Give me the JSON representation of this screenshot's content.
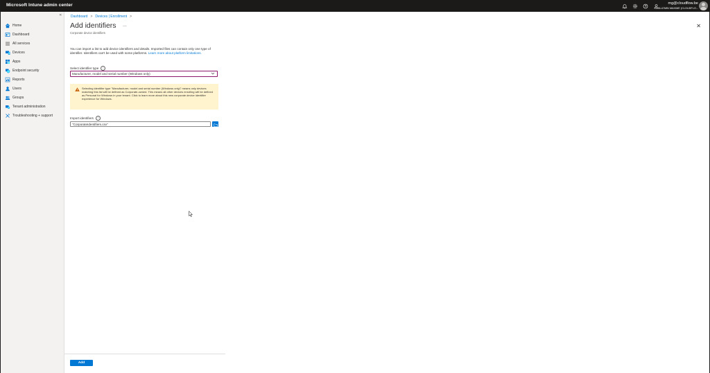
{
  "app": {
    "title": "Microsoft Intune admin center"
  },
  "account": {
    "email": "mg@cloudflow.be",
    "org": "GUILLEMIN MAXIME (CLOUDFLO..."
  },
  "topbar": {
    "icons": [
      "bell-icon",
      "gear-icon",
      "help-icon",
      "feedback-icon"
    ]
  },
  "sidebar": {
    "collapse_glyph": "«",
    "items": [
      {
        "label": "Home",
        "icon": "home-icon"
      },
      {
        "label": "Dashboard",
        "icon": "dashboard-icon"
      },
      {
        "label": "All services",
        "icon": "all-services-icon"
      },
      {
        "label": "Devices",
        "icon": "devices-icon"
      },
      {
        "label": "Apps",
        "icon": "apps-icon"
      },
      {
        "label": "Endpoint security",
        "icon": "endpoint-security-icon"
      },
      {
        "label": "Reports",
        "icon": "reports-icon"
      },
      {
        "label": "Users",
        "icon": "users-icon"
      },
      {
        "label": "Groups",
        "icon": "groups-icon"
      },
      {
        "label": "Tenant administration",
        "icon": "tenant-admin-icon"
      },
      {
        "label": "Troubleshooting + support",
        "icon": "troubleshooting-icon"
      }
    ]
  },
  "breadcrumb": {
    "items": [
      "Dashboard",
      "Devices | Enrollment"
    ],
    "sep": ">"
  },
  "page": {
    "title": "Add identifiers",
    "more": "...",
    "subtitle": "Corporate device identifiers",
    "close": "✕"
  },
  "description": {
    "text": "You can import a list to add device identifiers and details. Imported files can contain only one type of identifier. Identifiers can't be used with some platforms.",
    "link": "Learn more about platform limitations."
  },
  "identifier_type": {
    "label": "Select identifier type",
    "value": "Manufacturer, model and serial number (Windows only)"
  },
  "warning": {
    "text": "Selecting identifier type \"Manufacturer, model and serial number (Windows only)\" means only devices matching this list will be defined as Corporate-owned. This means all other devices enrolling will be defined as Personal for Windows in your tenant. Click to learn more about this new corporate device identifier experience for Windows."
  },
  "import": {
    "label": "Import identifiers",
    "value": "\"CorporateIdentifiers.csv\""
  },
  "footer": {
    "add_label": "Add"
  },
  "colors": {
    "accent": "#0078d4",
    "topbar": "#1b1a19",
    "warning_bg": "#fff4ce"
  }
}
